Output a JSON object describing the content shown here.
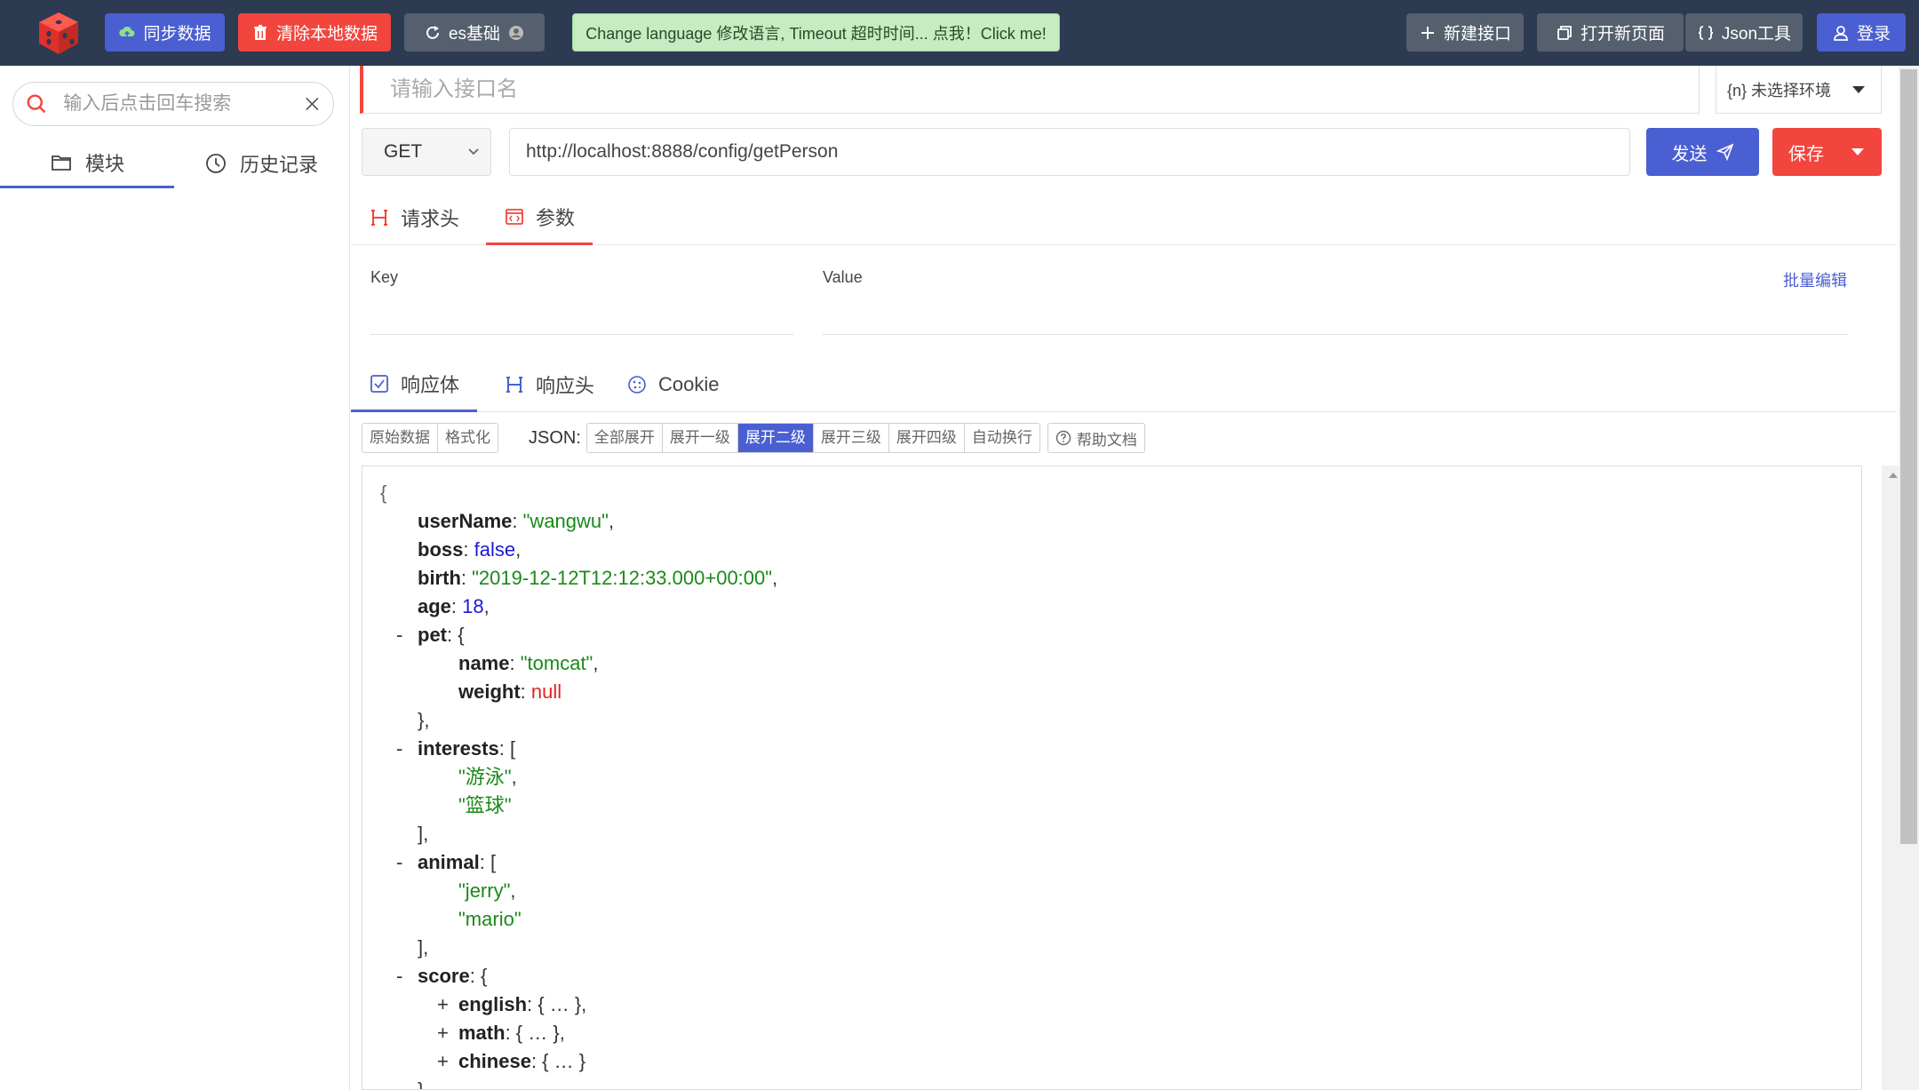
{
  "topbar": {
    "sync_label": "同步数据",
    "clear_label": "清除本地数据",
    "env_label": "es基础",
    "lang_tip": "Change language 修改语言, Timeout 超时时间... 点我！Click me!",
    "new_api_label": "新建接口",
    "open_page_label": "打开新页面",
    "json_tool_label": "Json工具",
    "login_label": "登录"
  },
  "sidebar": {
    "search_placeholder": "输入后点击回车搜索",
    "tabs": [
      {
        "label": "模块",
        "icon": "folder-icon",
        "active": true
      },
      {
        "label": "历史记录",
        "icon": "clock-icon",
        "active": false
      }
    ]
  },
  "request": {
    "name_placeholder": "请输入接口名",
    "env_select": "{n} 未选择环境",
    "method": "GET",
    "url": "http://localhost:8888/config/getPerson",
    "send_label": "发送",
    "save_label": "保存",
    "tabs": [
      {
        "label": "请求头",
        "active": false
      },
      {
        "label": "参数",
        "active": true
      }
    ],
    "kv": {
      "key_header": "Key",
      "value_header": "Value",
      "bulk_edit": "批量编辑"
    }
  },
  "response": {
    "tabs": [
      {
        "label": "响应体",
        "active": true
      },
      {
        "label": "响应头",
        "active": false
      },
      {
        "label": "Cookie",
        "active": false
      }
    ],
    "toolbar": {
      "raw": "原始数据",
      "format": "格式化",
      "json_label": "JSON:",
      "expand_all": "全部展开",
      "expand_1": "展开一级",
      "expand_2": "展开二级",
      "expand_3": "展开三级",
      "expand_4": "展开四级",
      "auto_wrap": "自动换行",
      "help_doc": "帮助文档",
      "active": "展开二级"
    }
  },
  "json_lines": [
    {
      "indent": 0,
      "toggle": "",
      "key": "",
      "colon": "",
      "value": "{",
      "vtype": "brace",
      "tail": ""
    },
    {
      "indent": 1,
      "toggle": "",
      "key": "userName",
      "colon": ": ",
      "value": "\"wangwu\"",
      "vtype": "str",
      "tail": ","
    },
    {
      "indent": 1,
      "toggle": "",
      "key": "boss",
      "colon": ": ",
      "value": "false",
      "vtype": "bool",
      "tail": ","
    },
    {
      "indent": 1,
      "toggle": "",
      "key": "birth",
      "colon": ": ",
      "value": "\"2019-12-12T12:12:33.000+00:00\"",
      "vtype": "str",
      "tail": ","
    },
    {
      "indent": 1,
      "toggle": "",
      "key": "age",
      "colon": ": ",
      "value": "18",
      "vtype": "num",
      "tail": ","
    },
    {
      "indent": 1,
      "toggle": "-",
      "key": "pet",
      "colon": ": ",
      "value": "{",
      "vtype": "punct",
      "tail": ""
    },
    {
      "indent": 2,
      "toggle": "",
      "key": "name",
      "colon": ": ",
      "value": "\"tomcat\"",
      "vtype": "str",
      "tail": ","
    },
    {
      "indent": 2,
      "toggle": "",
      "key": "weight",
      "colon": ": ",
      "value": "null",
      "vtype": "null",
      "tail": ""
    },
    {
      "indent": 1,
      "toggle": "",
      "key": "",
      "colon": "",
      "value": "},",
      "vtype": "punct",
      "tail": ""
    },
    {
      "indent": 1,
      "toggle": "-",
      "key": "interests",
      "colon": ": ",
      "value": "[",
      "vtype": "punct",
      "tail": ""
    },
    {
      "indent": 2,
      "toggle": "",
      "key": "",
      "colon": "",
      "value": "\"游泳\"",
      "vtype": "str",
      "tail": ","
    },
    {
      "indent": 2,
      "toggle": "",
      "key": "",
      "colon": "",
      "value": "\"篮球\"",
      "vtype": "str",
      "tail": ""
    },
    {
      "indent": 1,
      "toggle": "",
      "key": "",
      "colon": "",
      "value": "],",
      "vtype": "punct",
      "tail": ""
    },
    {
      "indent": 1,
      "toggle": "-",
      "key": "animal",
      "colon": ": ",
      "value": "[",
      "vtype": "punct",
      "tail": ""
    },
    {
      "indent": 2,
      "toggle": "",
      "key": "",
      "colon": "",
      "value": "\"jerry\"",
      "vtype": "str",
      "tail": ","
    },
    {
      "indent": 2,
      "toggle": "",
      "key": "",
      "colon": "",
      "value": "\"mario\"",
      "vtype": "str",
      "tail": ""
    },
    {
      "indent": 1,
      "toggle": "",
      "key": "",
      "colon": "",
      "value": "],",
      "vtype": "punct",
      "tail": ""
    },
    {
      "indent": 1,
      "toggle": "-",
      "key": "score",
      "colon": ": ",
      "value": "{",
      "vtype": "punct",
      "tail": ""
    },
    {
      "indent": 2,
      "toggle": "+",
      "key": "english",
      "colon": ": ",
      "value": "{ … }",
      "vtype": "punct",
      "tail": ","
    },
    {
      "indent": 2,
      "toggle": "+",
      "key": "math",
      "colon": ": ",
      "value": "{ … }",
      "vtype": "punct",
      "tail": ","
    },
    {
      "indent": 2,
      "toggle": "+",
      "key": "chinese",
      "colon": ": ",
      "value": "{ … }",
      "vtype": "punct",
      "tail": ""
    },
    {
      "indent": 1,
      "toggle": "",
      "key": "",
      "colon": "",
      "value": "}",
      "vtype": "punct",
      "tail": ""
    }
  ],
  "colors": {
    "topbar_bg": "#2c3a52",
    "primary": "#4a5fd1",
    "danger": "#f2453d",
    "json_string": "#1a8a1a",
    "json_bool": "#1a1ad6",
    "json_null": "#e02424"
  }
}
